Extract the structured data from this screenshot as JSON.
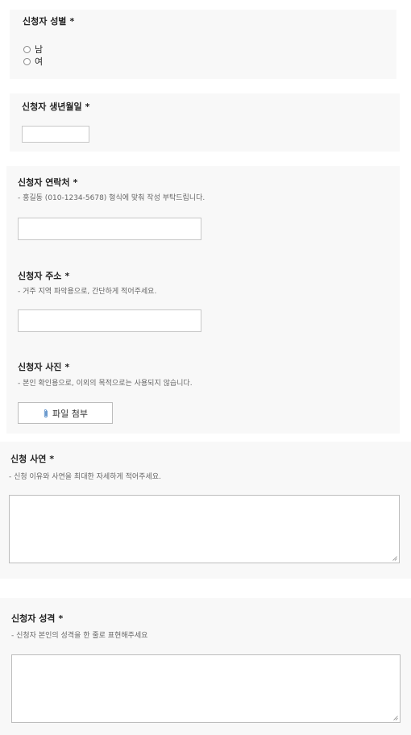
{
  "gender": {
    "title": "신청자 성별",
    "required_mark": "*",
    "options": [
      "남",
      "여"
    ]
  },
  "birth": {
    "title": "신청자 생년월일",
    "required_mark": "*",
    "value": ""
  },
  "contact": {
    "title": "신청자 연락처",
    "required_mark": "*",
    "help": "- 홍길동 (010-1234-5678) 형식에 맞춰 작성 부탁드립니다.",
    "value": ""
  },
  "address": {
    "title": "신청자 주소",
    "required_mark": "*",
    "help": "- 거주 지역 파악용으로, 간단하게 적어주세요.",
    "value": ""
  },
  "photo": {
    "title": "신청자 사진",
    "required_mark": "*",
    "help": "- 본인 확인용으로, 이외의 목적으로는 사용되지 않습니다.",
    "button_label": "파일 첨부",
    "icon": "paperclip-icon"
  },
  "reason": {
    "title": "신청 사연",
    "required_mark": "*",
    "help": "- 신청 이유와 사연을 최대한 자세하게 적어주세요.",
    "value": ""
  },
  "personality": {
    "title": "신청자 성격",
    "required_mark": "*",
    "help": "- 신청자 본인의 성격을 한 줄로 표현해주세요",
    "value": ""
  }
}
